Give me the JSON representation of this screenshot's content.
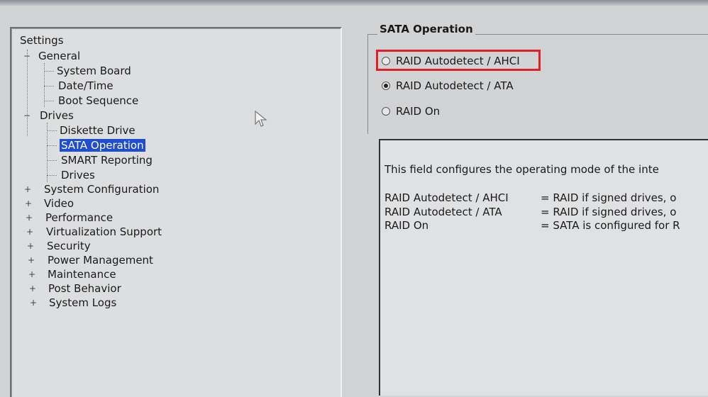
{
  "tree": {
    "root_label": "Settings",
    "groups": [
      {
        "label": "General",
        "expander": "−",
        "expanded": true,
        "children": [
          "System Board",
          "Date/Time",
          "Boot Sequence"
        ]
      },
      {
        "label": "Drives",
        "expander": "−",
        "expanded": true,
        "children": [
          "Diskette Drive",
          "SATA Operation",
          "SMART Reporting",
          "Drives"
        ]
      }
    ],
    "selected": "SATA Operation",
    "collapsed": [
      {
        "label": "System Configuration",
        "expander": "+"
      },
      {
        "label": "Video",
        "expander": "+"
      },
      {
        "label": "Performance",
        "expander": "+"
      },
      {
        "label": "Virtualization Support",
        "expander": "+"
      },
      {
        "label": "Security",
        "expander": "+"
      },
      {
        "label": "Power Management",
        "expander": "+"
      },
      {
        "label": "Maintenance",
        "expander": "+"
      },
      {
        "label": "Post Behavior",
        "expander": "+"
      },
      {
        "label": "System Logs",
        "expander": "+"
      }
    ]
  },
  "sata": {
    "title": "SATA Operation",
    "options": [
      {
        "label": "RAID Autodetect / AHCI",
        "checked": false
      },
      {
        "label": "RAID Autodetect / ATA",
        "checked": true
      },
      {
        "label": "RAID On",
        "checked": false
      }
    ],
    "highlight_color": "#e0202a"
  },
  "description": {
    "intro": "This field configures the operating mode of the inte",
    "rows": [
      {
        "name": "RAID Autodetect / AHCI",
        "value": "= RAID if signed drives, o"
      },
      {
        "name": "RAID Autodetect / ATA",
        "value": "= RAID if signed drives, o"
      },
      {
        "name": "RAID On",
        "value": "= SATA is configured for R"
      }
    ]
  }
}
